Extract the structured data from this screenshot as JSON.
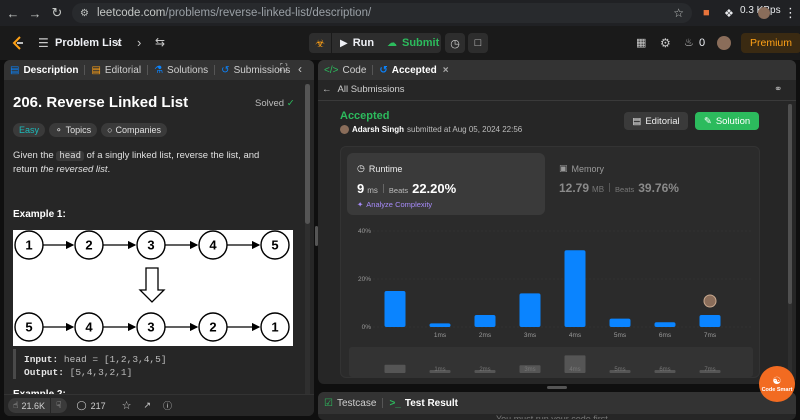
{
  "browser": {
    "url_host": "leetcode.com",
    "url_path": "/problems/reverse-linked-list/description/",
    "net_speed": "0.3 KBps"
  },
  "nav": {
    "problem_list": "Problem List",
    "run": "Run",
    "submit": "Submit",
    "fire_count": "0",
    "premium": "Premium"
  },
  "left": {
    "tabs": [
      {
        "label": "Description"
      },
      {
        "label": "Editorial"
      },
      {
        "label": "Solutions"
      },
      {
        "label": "Submissions"
      }
    ],
    "title": "206. Reverse Linked List",
    "status": "Solved",
    "tags": [
      "Easy",
      "Topics",
      "Companies"
    ],
    "desc_pre": "Given the ",
    "desc_code": "head",
    "desc_mid": " of a singly linked list, reverse the list, and return ",
    "desc_em": "the reversed list",
    "desc_end": ".",
    "example_title": "Example 1:",
    "list_top": [
      "1",
      "2",
      "3",
      "4",
      "5"
    ],
    "list_bottom": [
      "5",
      "4",
      "3",
      "2",
      "1"
    ],
    "input_label": "Input:",
    "input_value": "head = [1,2,3,4,5]",
    "output_label": "Output:",
    "output_value": "[5,4,3,2,1]",
    "example2_partial": "Example 2:",
    "likes": "21.6K",
    "comments": "217"
  },
  "right": {
    "tabs": [
      {
        "label": "Code"
      },
      {
        "label": "Accepted"
      }
    ],
    "all_submissions": "All Submissions",
    "verdict": "Accepted",
    "user": "Adarsh Singh",
    "submitted_text": "submitted at Aug 05, 2024 22:56",
    "editorial_btn": "Editorial",
    "solution_btn": "Solution",
    "runtime": {
      "label": "Runtime",
      "value": "9",
      "unit": "ms",
      "beats_label": "Beats",
      "beats": "22.20%",
      "analyze": "Analyze Complexity"
    },
    "memory": {
      "label": "Memory",
      "value": "12.79",
      "unit": "MB",
      "beats_label": "Beats",
      "beats": "39.76%"
    },
    "bottom_tabs": [
      {
        "label": "Testcase"
      },
      {
        "label": "Test Result"
      }
    ],
    "bottom_hint": "You must run your code first",
    "code_smart": "Code Smart"
  },
  "colors": {
    "accent_green": "#2cbb5d",
    "bar_blue": "#0a84ff",
    "easy": "#1cbaba",
    "premium": "#ffa116"
  },
  "chart_data": {
    "type": "bar",
    "yticks": [
      "40%",
      "20%",
      "0%"
    ],
    "ylim": [
      0,
      40
    ],
    "categories": [
      "",
      "1ms",
      "2ms",
      "3ms",
      "4ms",
      "5ms",
      "6ms",
      "7ms"
    ],
    "values": [
      15,
      1.5,
      5,
      14,
      32,
      3.5,
      2,
      5
    ]
  }
}
